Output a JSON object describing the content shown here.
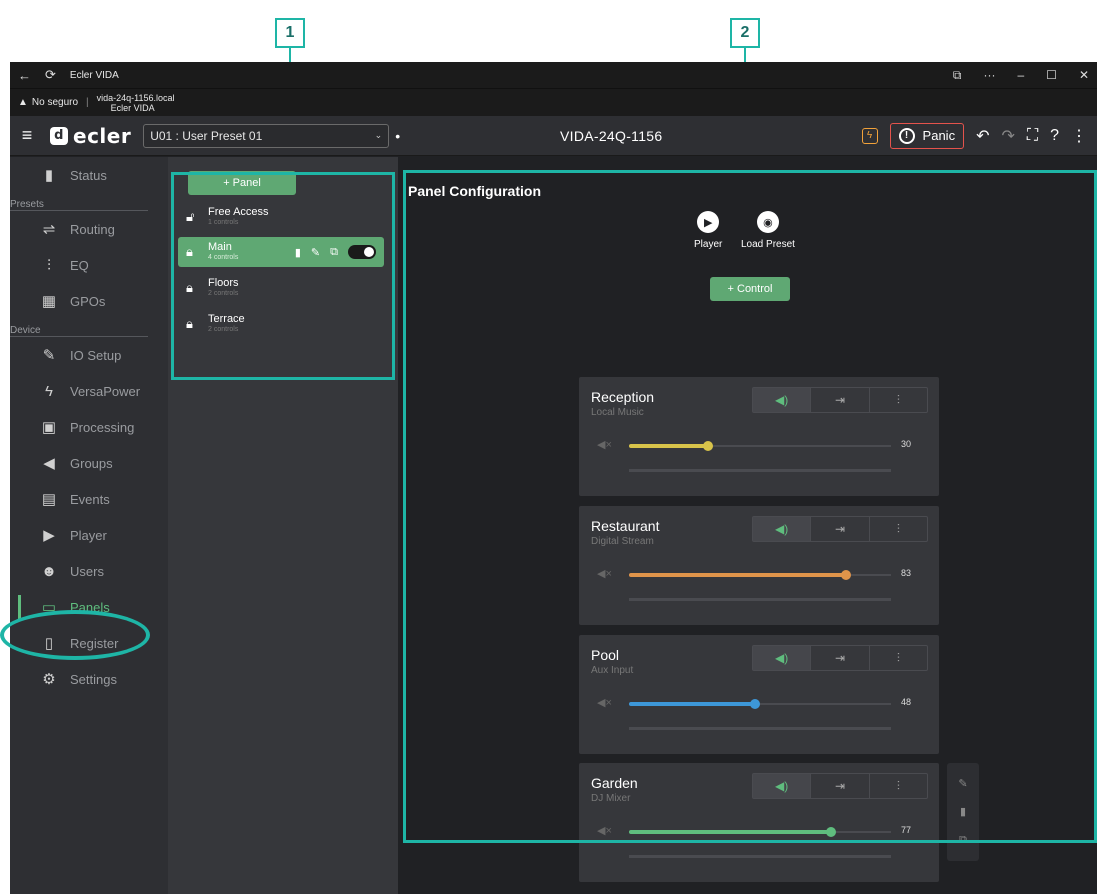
{
  "callouts": [
    "1",
    "2"
  ],
  "window": {
    "title": "Ecler VIDA",
    "security_label": "No seguro",
    "address": "vida-24q-1156.local",
    "address_sub": "Ecler VIDA"
  },
  "appbar": {
    "logo": "ecler",
    "preset": "U01 : User Preset 01",
    "unsaved_dot": "•",
    "device_name": "VIDA-24Q-1156",
    "panic_label": "Panic"
  },
  "sidebar": {
    "items": [
      {
        "label": "Status",
        "icon": "status-icon"
      },
      {
        "section": "Presets"
      },
      {
        "label": "Routing",
        "icon": "routing-icon"
      },
      {
        "label": "EQ",
        "icon": "eq-icon"
      },
      {
        "label": "GPOs",
        "icon": "gpo-icon"
      },
      {
        "section": "Device"
      },
      {
        "label": "IO Setup",
        "icon": "wrench-icon"
      },
      {
        "label": "VersaPower",
        "icon": "bolt-icon"
      },
      {
        "label": "Processing",
        "icon": "chip-icon"
      },
      {
        "label": "Groups",
        "icon": "speaker-icon"
      },
      {
        "label": "Events",
        "icon": "calendar-icon"
      },
      {
        "label": "Player",
        "icon": "play-icon"
      },
      {
        "label": "Users",
        "icon": "users-icon"
      },
      {
        "label": "Panels",
        "icon": "panels-icon",
        "active": true
      },
      {
        "label": "Register",
        "icon": "file-icon"
      },
      {
        "label": "Settings",
        "icon": "gear-icon"
      }
    ]
  },
  "panels": {
    "add_label": "+ Panel",
    "list": [
      {
        "name": "Free Access",
        "sub": "1 controls"
      },
      {
        "name": "Main",
        "sub": "4 controls",
        "selected": true
      },
      {
        "name": "Floors",
        "sub": "2 controls"
      },
      {
        "name": "Terrace",
        "sub": "2 controls"
      }
    ]
  },
  "main": {
    "title": "Panel Configuration",
    "quick_player": "Player",
    "quick_load_preset": "Load Preset",
    "add_control_label": "+ Control",
    "cards": [
      {
        "name": "Reception",
        "source": "Local Music",
        "value": 30,
        "color": "#d8c34a"
      },
      {
        "name": "Restaurant",
        "source": "Digital Stream",
        "value": 83,
        "color": "#e0944a"
      },
      {
        "name": "Pool",
        "source": "Aux Input",
        "value": 48,
        "color": "#3d97d8"
      },
      {
        "name": "Garden",
        "source": "DJ Mixer",
        "value": 77,
        "color": "#5fbd7e"
      }
    ]
  },
  "colors": {
    "accent": "#5fa873",
    "callout": "#1eb5a6",
    "panic": "#e4534c"
  }
}
